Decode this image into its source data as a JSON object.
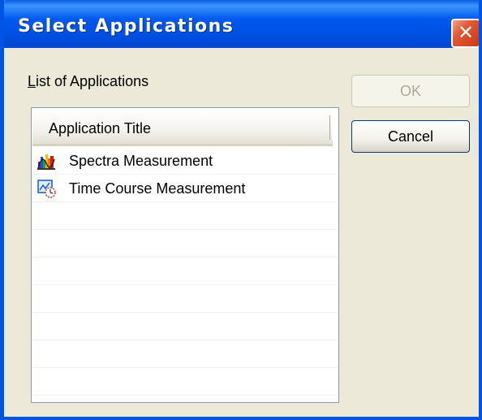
{
  "window": {
    "title": "Select Applications",
    "close_glyph": "✕",
    "close_icon": "close-icon"
  },
  "list": {
    "label_mnemonic": "L",
    "label_rest": "ist of Applications",
    "header_title": "Application Title",
    "items": [
      {
        "label": "Spectra Measurement",
        "icon": "spectra-measurement-icon"
      },
      {
        "label": "Time Course Measurement",
        "icon": "time-course-measurement-icon"
      }
    ]
  },
  "buttons": {
    "ok_label": "OK",
    "ok_enabled": false,
    "cancel_label": "Cancel"
  },
  "colors": {
    "titlebar": "#0058ee",
    "dialog_background": "#ece9d8",
    "close_button": "#e25a34",
    "list_border": "#7f9db9"
  }
}
